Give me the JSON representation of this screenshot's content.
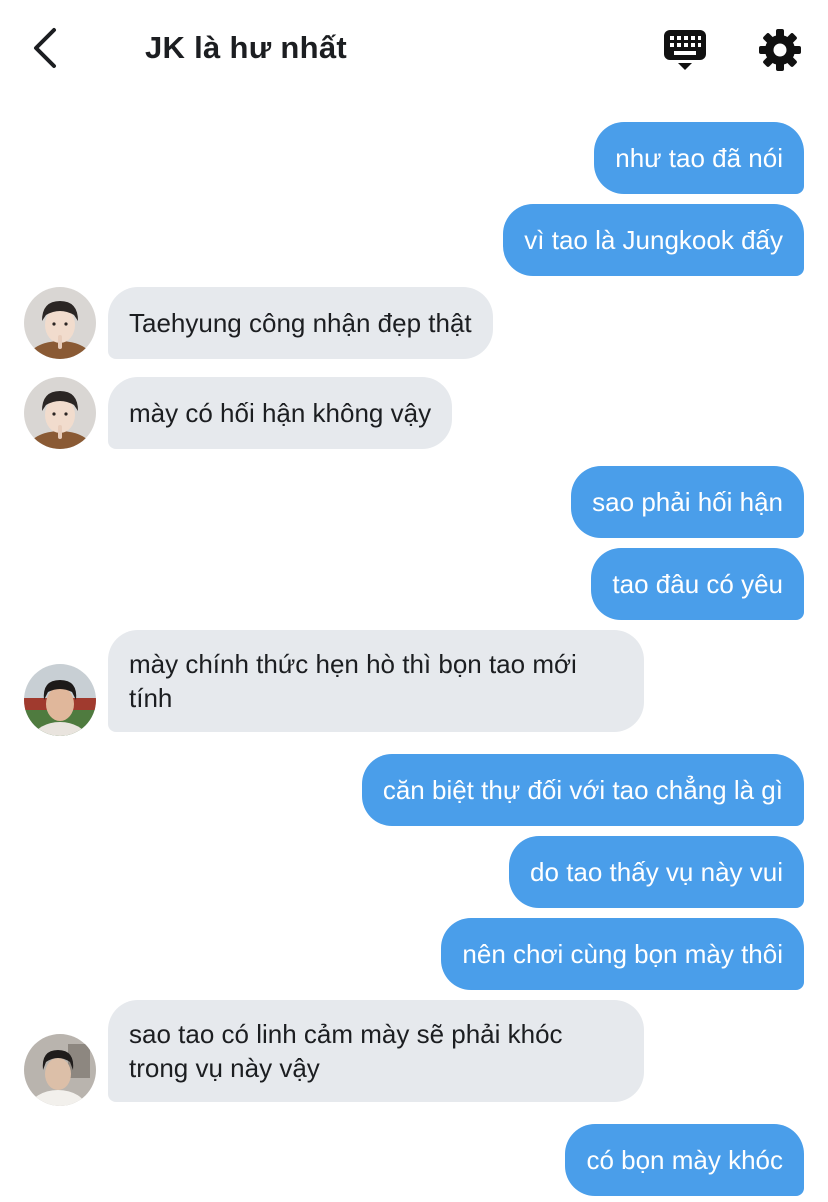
{
  "header": {
    "title": "JK là hư nhất",
    "back_icon": "chevron-left-icon",
    "keyboard_icon": "keyboard-icon",
    "settings_icon": "gear-icon"
  },
  "colors": {
    "outgoing_bubble": "#4a9eea",
    "incoming_bubble": "#e6e9ed",
    "text_dark": "#1c1e21",
    "text_light": "#ffffff"
  },
  "messages": [
    {
      "direction": "out",
      "text": "như tao đã nói"
    },
    {
      "direction": "out",
      "text": "vì tao là Jungkook đấy"
    },
    {
      "direction": "in",
      "sender": "girl",
      "text": "Taehyung công nhận đẹp thật"
    },
    {
      "direction": "in",
      "sender": "girl",
      "text": "mày có hối hận không vậy"
    },
    {
      "direction": "out",
      "text": "sao phải hối hận"
    },
    {
      "direction": "out",
      "text": "tao đâu có yêu"
    },
    {
      "direction": "in",
      "sender": "boy1",
      "text": "mày chính thức hẹn hò thì bọn tao mới tính"
    },
    {
      "direction": "out",
      "text": "căn biệt thự đối với tao chẳng là gì"
    },
    {
      "direction": "out",
      "text": "do tao thấy vụ này vui"
    },
    {
      "direction": "out",
      "text": "nên chơi cùng bọn mày thôi"
    },
    {
      "direction": "in",
      "sender": "boy2",
      "text": "sao tao có linh cảm mày sẽ phải khóc trong vụ này vậy"
    },
    {
      "direction": "out",
      "text": "có bọn mày khóc"
    }
  ]
}
